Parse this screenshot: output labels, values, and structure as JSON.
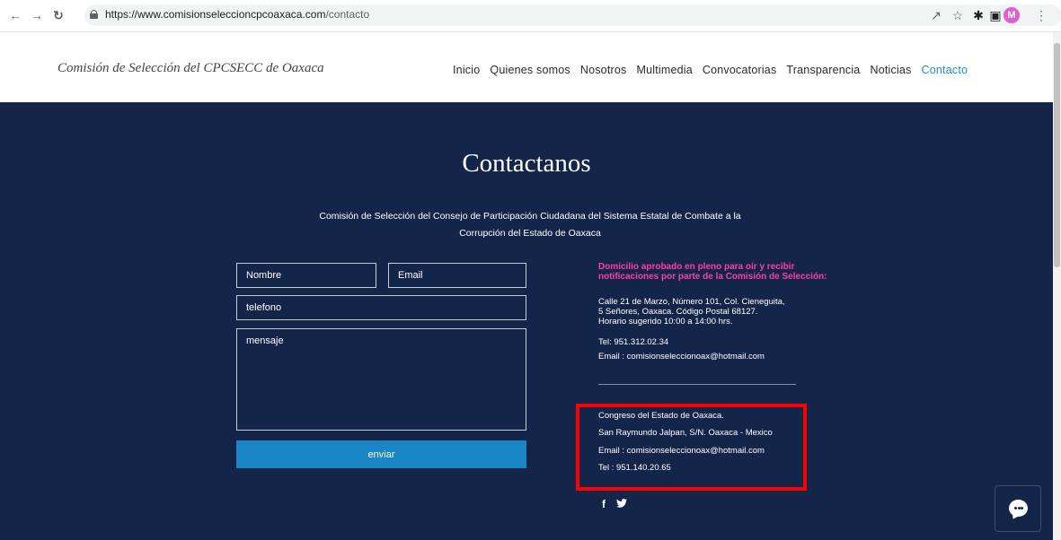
{
  "browser": {
    "url_host": "https://www.comisionseleccioncpcoaxaca.com",
    "url_path": "/contacto",
    "profile_initial": "M"
  },
  "site": {
    "title": "Comisión de Selección del CPCSECC de Oaxaca",
    "nav": [
      "Inicio",
      "Quienes somos",
      "Nosotros",
      "Multimedia",
      "Convocatorias",
      "Transparencia",
      "Noticias",
      "Contacto"
    ],
    "active_nav": "Contacto"
  },
  "main": {
    "heading": "Contactanos",
    "subtitle_line1": "Comisión de Selección del Consejo de Participación Ciudadana del Sistema Estatal de Combate a la",
    "subtitle_line2": "Corrupción del Estado de Oaxaca"
  },
  "form": {
    "name_placeholder": "Nombre",
    "email_placeholder": "Email",
    "phone_placeholder": "telefono",
    "message_placeholder": "mensaje",
    "submit_label": "enviar"
  },
  "info": {
    "notice_line1": "Domicilio aprobado en pleno para oír y recibir",
    "notice_line2": "notificaciones por parte de la Comisión de Selección:",
    "address_line1": "Calle 21 de Marzo, Número 101, Col. Cieneguita,",
    "address_line2": "5 Señores, Oaxaca. Código Postal 68127.",
    "hours": "Horario sugerido 10:00 a 14:00 hrs.",
    "tel": "Tel: 951.312.02.34",
    "email": "Email : comisionseleccionoax@hotmail.com",
    "congress_name": "Congreso del Estado de Oaxaca.",
    "congress_address": "San Raymundo Jalpan, S/N. Oaxaca - Mexico",
    "congress_email": "Email : comisionseleccionoax@hotmail.com",
    "congress_tel": "Tel : 951.140.20.65"
  },
  "colors": {
    "background_dark": "#14254a",
    "accent_pink": "#ff3ea5",
    "button_blue": "#1a85c4",
    "highlight_red": "#ff0000"
  },
  "icons": [
    "back-icon",
    "forward-icon",
    "reload-icon",
    "lock-icon",
    "share-icon",
    "star-icon",
    "extensions-icon",
    "sidebar-icon",
    "menu-icon",
    "facebook-icon",
    "twitter-icon",
    "chat-icon"
  ]
}
